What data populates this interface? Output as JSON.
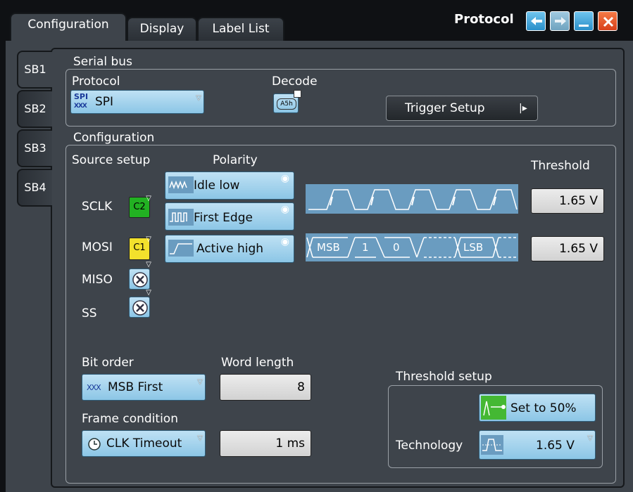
{
  "header": {
    "tabs": [
      "Configuration",
      "Display",
      "Label List"
    ],
    "title": "Protocol"
  },
  "sidebar": {
    "items": [
      "SB1",
      "SB2",
      "SB3",
      "SB4"
    ]
  },
  "serial_bus": {
    "heading": "Serial bus",
    "protocol_label": "Protocol",
    "protocol_value": "SPI",
    "protocol_icon_text": "SPI",
    "decode_label": "Decode",
    "decode_icon_text": "A5h",
    "trigger_setup": "Trigger Setup"
  },
  "configuration": {
    "heading": "Configuration",
    "source_setup": "Source setup",
    "polarity": "Polarity",
    "threshold": "Threshold",
    "signals": [
      {
        "name": "SCLK",
        "source": "C2",
        "source_color": "#22b122"
      },
      {
        "name": "MOSI",
        "source": "C1",
        "source_color": "#f2e12c"
      },
      {
        "name": "MISO",
        "source": "off"
      },
      {
        "name": "SS",
        "source": "off"
      }
    ],
    "polarity_buttons": [
      "Idle low",
      "First Edge",
      "Active high"
    ],
    "thresholds": [
      "1.65 V",
      "1.65 V"
    ],
    "mosi_wave_labels": [
      "MSB",
      "1",
      "0",
      "LSB"
    ],
    "bit_order_label": "Bit order",
    "bit_order_value": "MSB First",
    "word_length_label": "Word length",
    "word_length_value": "8",
    "frame_condition_label": "Frame condition",
    "frame_condition_value": "CLK Timeout",
    "frame_timeout_value": "1 ms",
    "threshold_setup": {
      "heading": "Threshold setup",
      "set_button": "Set to 50%",
      "technology_label": "Technology",
      "technology_value": "1.65 V"
    }
  },
  "colors": {
    "accent_blue": "#9fd3ef",
    "panel": "#3e444b",
    "close_red": "#e8501e"
  }
}
